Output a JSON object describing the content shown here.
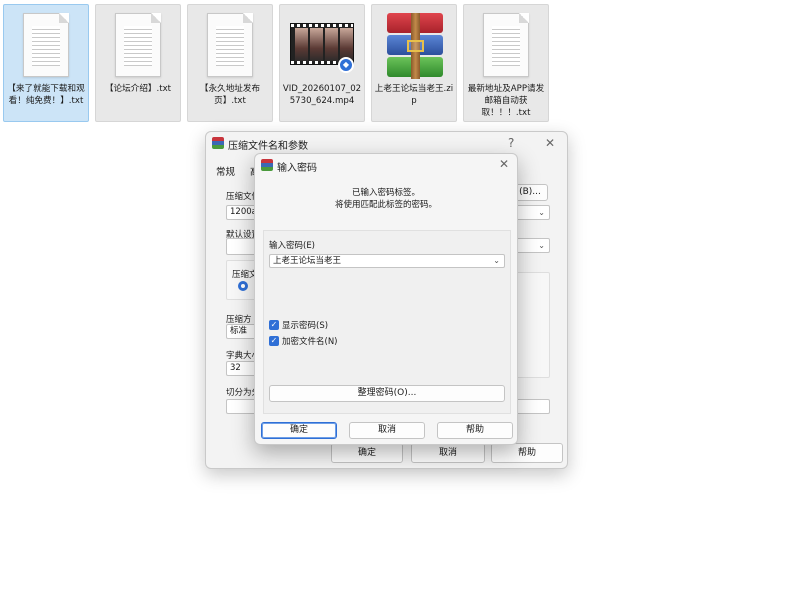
{
  "desktop": {
    "files": [
      {
        "name": "【来了就能下载和观看！纯免费！】.txt",
        "type": "txt"
      },
      {
        "name": "【论坛介绍】.txt",
        "type": "txt"
      },
      {
        "name": "【永久地址发布页】.txt",
        "type": "txt"
      },
      {
        "name": "VID_20260107_025730_624.mp4",
        "type": "video"
      },
      {
        "name": "上老王论坛当老王.zip",
        "type": "archive"
      },
      {
        "name": "最新地址及APP请发邮箱自动获取！！！.txt",
        "type": "txt"
      }
    ]
  },
  "archive_dialog": {
    "title": "压缩文件名和参数",
    "help_icon": "?",
    "close_icon": "✕",
    "tabs": [
      "常规",
      "高"
    ],
    "archive_name_label": "压缩文件",
    "archive_name_value": "1200a",
    "browse_button": "(B)...",
    "default_settings_label": "默认设置",
    "format_label": "压缩文",
    "method_label": "压缩方",
    "method_value": "标准",
    "dict_label": "字典大小",
    "dict_value": "32",
    "split_label": "切分为分",
    "ok": "确定",
    "cancel": "取消",
    "help": "帮助"
  },
  "password_dialog": {
    "title": "输入密码",
    "info_line1": "已输入密码标签。",
    "info_line2": "将使用匹配此标签的密码。",
    "password_label": "输入密码(E)",
    "password_value": "上老王论坛当老王",
    "show_password_label": "显示密码(S)",
    "encrypt_names_label": "加密文件名(N)",
    "organize_button": "整理密码(O)...",
    "ok": "确定",
    "cancel": "取消",
    "help": "帮助",
    "accent": "#2f6fd6"
  }
}
